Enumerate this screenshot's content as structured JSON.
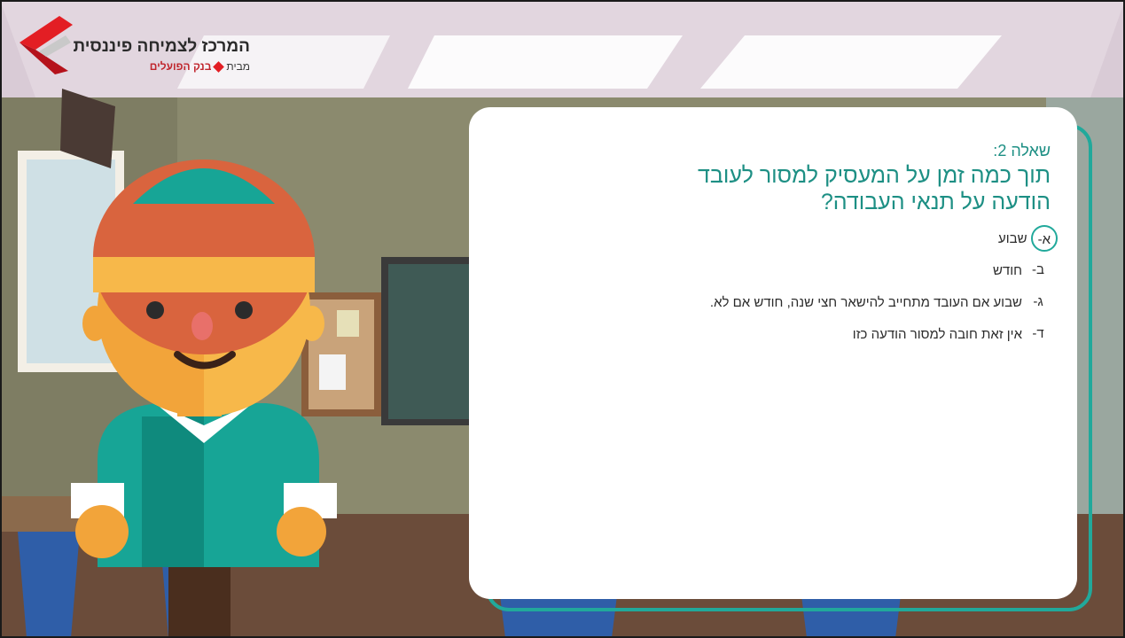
{
  "logo": {
    "title": "המרכז לצמיחה פיננסית",
    "subtitle_prefix": "מבית",
    "subtitle_brand": "בנק הפועלים"
  },
  "quiz": {
    "question_label": "שאלה 2:",
    "question_text": "תוך כמה זמן על המעסיק למסור לעובד הודעה על תנאי העבודה?",
    "answers": [
      {
        "letter": "א-",
        "text": "שבוע",
        "selected": true
      },
      {
        "letter": "ב-",
        "text": "חודש",
        "selected": false
      },
      {
        "letter": "ג-",
        "text": "שבוע אם העובד מתחייב להישאר חצי שנה, חודש אם לא.",
        "selected": false
      },
      {
        "letter": "ד-",
        "text": "אין זאת חובה למסור הודעה כזו",
        "selected": false
      }
    ]
  },
  "colors": {
    "accent": "#21a99b",
    "brand_red": "#e31e24"
  }
}
